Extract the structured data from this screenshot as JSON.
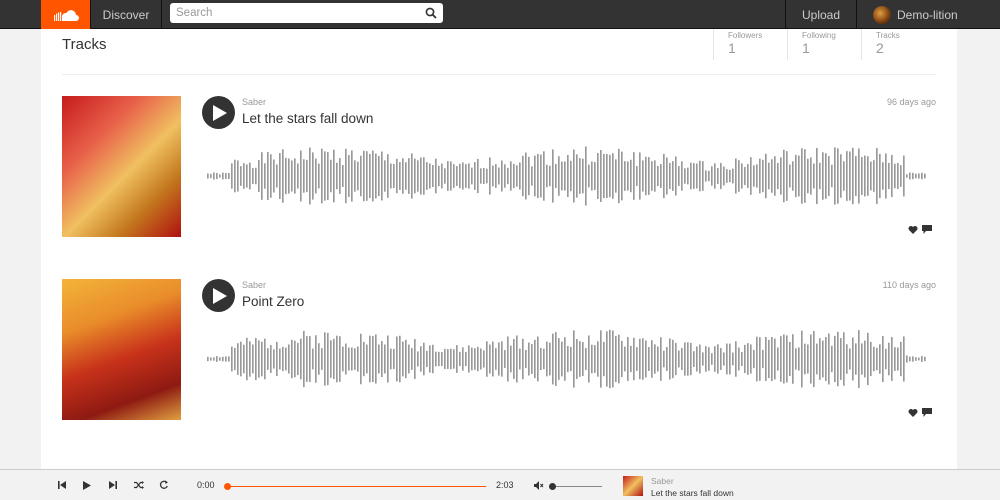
{
  "nav": {
    "discover_label": "Discover",
    "search_placeholder": "Search",
    "upload_label": "Upload",
    "username": "Demo-lition",
    "brand_color": "#ff5500"
  },
  "page": {
    "title": "Tracks",
    "stats": [
      {
        "label": "Followers",
        "value": "1"
      },
      {
        "label": "Following",
        "value": "1"
      },
      {
        "label": "Tracks",
        "value": "2"
      }
    ]
  },
  "tracks": [
    {
      "artist": "Saber",
      "title": "Let the stars fall down",
      "age": "96 days ago",
      "icons": [
        "play-icon",
        "heart-icon",
        "comment-icon"
      ]
    },
    {
      "artist": "Saber",
      "title": "Point Zero",
      "age": "110 days ago",
      "icons": [
        "play-icon",
        "heart-icon",
        "comment-icon"
      ]
    }
  ],
  "player": {
    "current_time": "0:00",
    "duration": "2:03",
    "progress": 0,
    "volume_level": 0,
    "now_playing_artist": "Saber",
    "now_playing_title": "Let the stars fall down",
    "icons": [
      "previous-icon",
      "play-icon",
      "next-icon",
      "shuffle-icon",
      "repeat-icon",
      "volume-icon"
    ]
  }
}
